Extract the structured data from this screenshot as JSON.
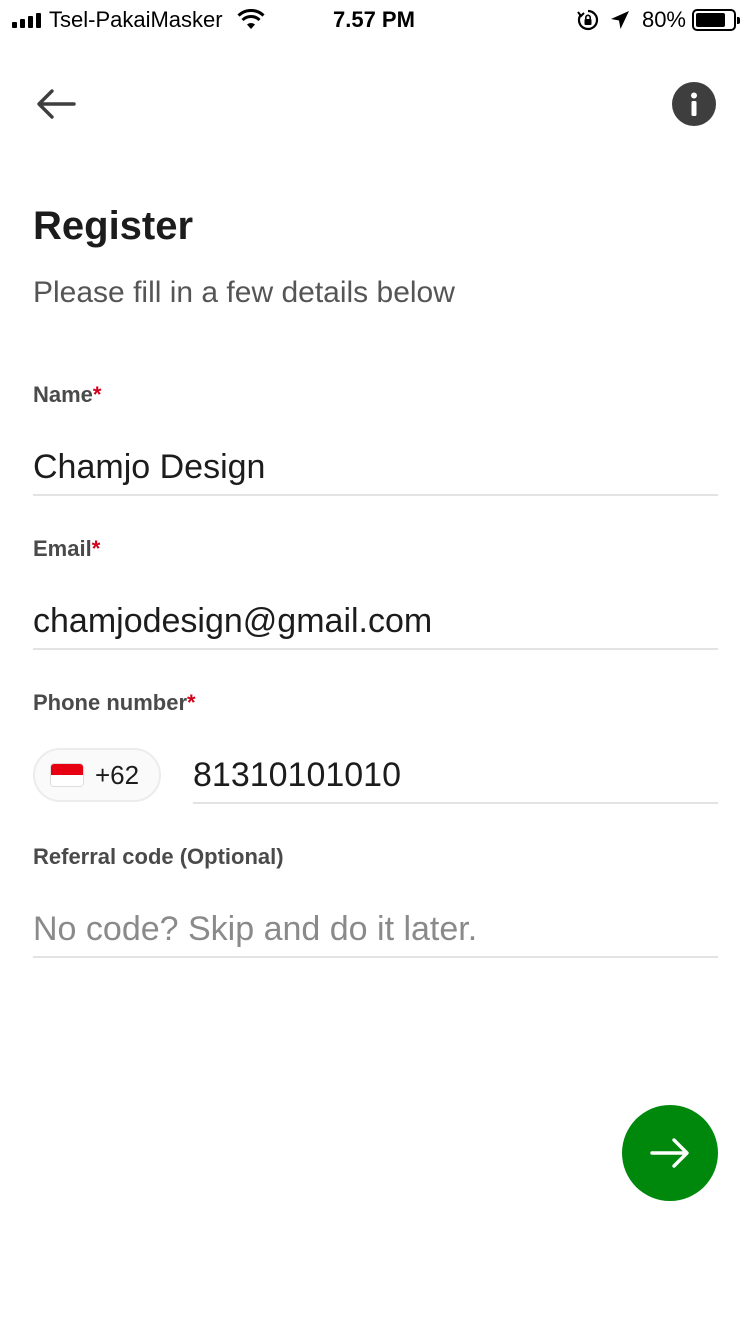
{
  "status_bar": {
    "carrier": "Tsel-PakaiMasker",
    "time": "7.57 PM",
    "battery_percent": "80%",
    "battery_level": 0.8,
    "icons": [
      "signal-icon",
      "wifi-icon",
      "rotation-lock-icon",
      "location-icon",
      "battery-icon"
    ]
  },
  "nav": {
    "back_icon": "arrow-left-icon",
    "info_icon": "info-icon"
  },
  "header": {
    "title": "Register",
    "subtitle": "Please fill in a few details below"
  },
  "form": {
    "name": {
      "label": "Name",
      "required_mark": "*",
      "value": "Chamjo Design"
    },
    "email": {
      "label": "Email",
      "required_mark": "*",
      "value": "chamjodesign@gmail.com"
    },
    "phone": {
      "label": "Phone number",
      "required_mark": "*",
      "country_code": "+62",
      "value": "81310101010"
    },
    "referral": {
      "label": "Referral code (Optional)",
      "value": "",
      "placeholder": "No code? Skip and do it later."
    }
  },
  "next_button": {
    "icon": "arrow-right-icon",
    "color": "#00880d"
  }
}
